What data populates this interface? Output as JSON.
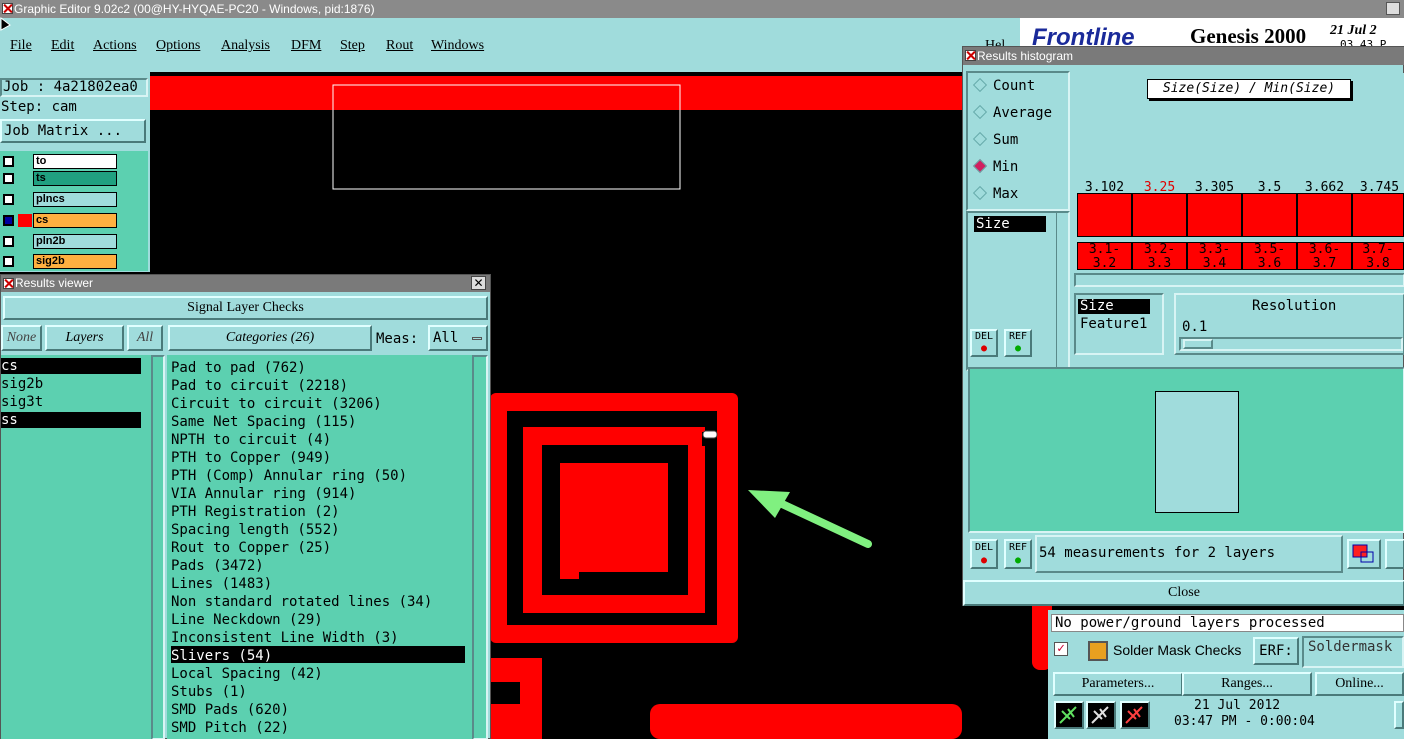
{
  "window": {
    "title": "Graphic Editor 9.02c2 (00@HY-HYQAE-PC20 - Windows, pid:1876)"
  },
  "menu": [
    "File",
    "Edit",
    "Actions",
    "Options",
    "Analysis",
    "DFM",
    "Step",
    "Rout",
    "Windows"
  ],
  "menu_right": "Hel",
  "brand": {
    "logo": "Frontline",
    "product": "Genesis 2000",
    "date": "21 Jul 2",
    "time": "03 43 P"
  },
  "job": {
    "job_label": "Job : 4a21802ea0",
    "step_label": "Step: cam",
    "matrix_button": "Job Matrix ..."
  },
  "layers": [
    {
      "name": "to",
      "color": "#ffffff"
    },
    {
      "name": "ts",
      "color": "#20a080"
    },
    {
      "name": "plncs",
      "color": "#a0dcdc"
    },
    {
      "name": "cs",
      "color": "#ffb040"
    },
    {
      "name": "pln2b",
      "color": "#a0dcdc"
    },
    {
      "name": "sig2b",
      "color": "#ffb040"
    }
  ],
  "results_viewer": {
    "title": "Results viewer",
    "heading": "Signal Layer Checks",
    "none_btn": "None",
    "layers_btn": "Layers",
    "all_btn": "All",
    "categories_btn": "Categories (26)",
    "meas_label": "Meas:",
    "meas_value": "All",
    "layer_list": [
      "cs",
      "sig2b",
      "sig3t",
      "ss"
    ],
    "categories": [
      "Pad to pad (762)",
      "Pad to circuit (2218)",
      "Circuit to circuit (3206)",
      "Same Net Spacing (115)",
      "NPTH to circuit (4)",
      "PTH to Copper (949)",
      "PTH (Comp) Annular ring (50)",
      "VIA Annular ring (914)",
      "PTH Registration (2)",
      "Spacing length (552)",
      "Rout to Copper (25)",
      "Pads (3472)",
      "Lines (1483)",
      "Non standard rotated lines (34)",
      "Line Neckdown (29)",
      "Inconsistent Line Width (3)",
      "Slivers (54)",
      "Local Spacing (42)",
      "Stubs (1)",
      "SMD Pads (620)",
      "SMD Pitch (22)"
    ],
    "selected_category": "Slivers (54)"
  },
  "histogram": {
    "title": "Results histogram",
    "radios": [
      "Count",
      "Average",
      "Sum",
      "Min",
      "Max"
    ],
    "selected_radio": "Min",
    "chart_title": "Size(Size) / Min(Size)",
    "field_list": [
      "Size"
    ],
    "bars": [
      {
        "value": "3.102",
        "range": "3.1-3.2",
        "highlight": false
      },
      {
        "value": "3.25",
        "range": "3.2-3.3",
        "highlight": true
      },
      {
        "value": "3.305",
        "range": "3.3-3.4",
        "highlight": false
      },
      {
        "value": "3.5",
        "range": "3.5-3.6",
        "highlight": false
      },
      {
        "value": "3.662",
        "range": "3.6-3.7",
        "highlight": false
      },
      {
        "value": "3.745",
        "range": "3.7-3.8",
        "highlight": false
      }
    ],
    "axis_list": [
      "Size",
      "Feature1"
    ],
    "resolution_label": "Resolution",
    "resolution_value": "0.1",
    "del_label": "DEL",
    "ref_label": "REF",
    "measurements": "54 measurements for 2 layers",
    "close": "Close"
  },
  "status": {
    "message": "No power/ground layers processed",
    "check_name": "Solder Mask Checks",
    "erf_label": "ERF:",
    "erf_value": "Soldermask",
    "params_btn": "Parameters...",
    "ranges_btn": "Ranges...",
    "online_btn": "Online...",
    "date": "21 Jul 2012",
    "time": "03:47 PM - 0:00:04"
  },
  "colors": {
    "copper": "#ff0000",
    "panel": "#a0dcdc",
    "list": "#5cd0b0",
    "arrow": "#80f080"
  }
}
